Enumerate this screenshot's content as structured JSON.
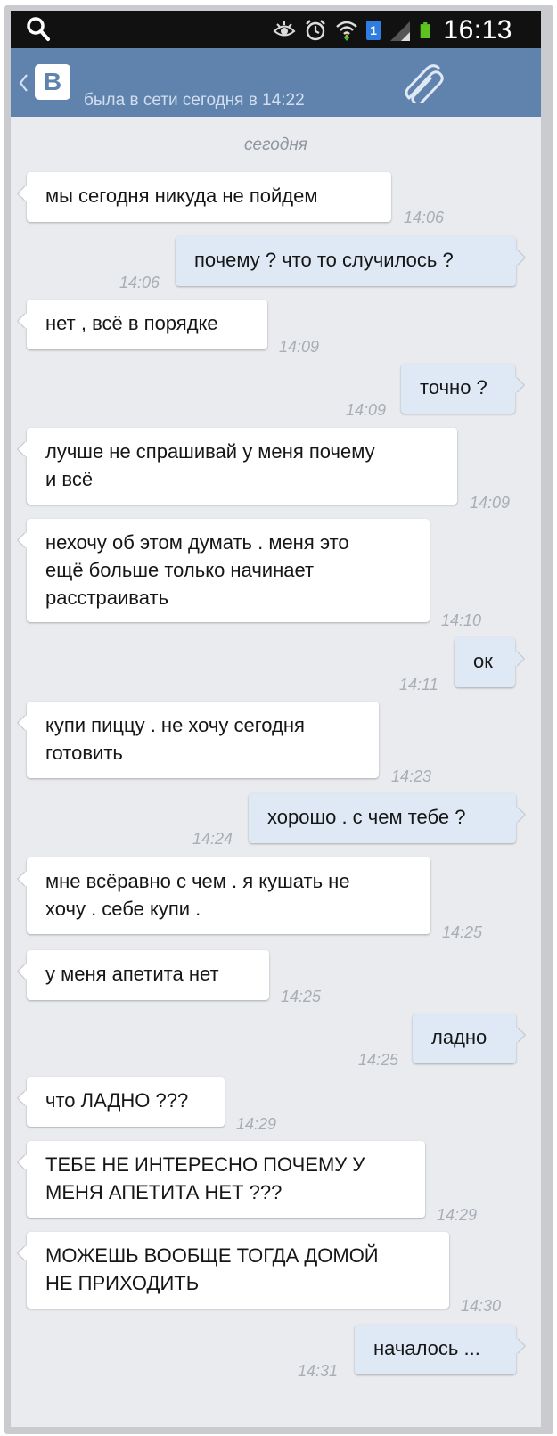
{
  "status_bar": {
    "time": "16:13",
    "badge": "1",
    "icons": [
      "search-icon",
      "eye-icon",
      "alarm-icon",
      "wifi-icon",
      "sim-badge-icon",
      "signal-icon",
      "battery-icon"
    ]
  },
  "header": {
    "logo": "В",
    "status": "была в сети сегодня в 14:22",
    "color": "#5f83ad"
  },
  "chat": {
    "date_label": "сегодня",
    "messages": [
      {
        "side": "in",
        "lines": [
          "мы сегодня никуда не пойдем"
        ],
        "time": "14:06"
      },
      {
        "side": "out",
        "lines": [
          "почему ? что то случилось ?"
        ],
        "time": "14:06"
      },
      {
        "side": "in",
        "lines": [
          "нет , всё в порядке"
        ],
        "time": "14:09"
      },
      {
        "side": "out",
        "lines": [
          "точно ?"
        ],
        "time": "14:09"
      },
      {
        "side": "in",
        "lines": [
          "лучше не спрашивай у меня почему",
          "и всё"
        ],
        "time": "14:09"
      },
      {
        "side": "in",
        "lines": [
          "нехочу об этом думать . меня это",
          "ещё больше только начинает",
          "расстраивать"
        ],
        "time": "14:10"
      },
      {
        "side": "out",
        "lines": [
          "ок"
        ],
        "time": "14:11"
      },
      {
        "side": "in",
        "lines": [
          "купи пиццу . не хочу сегодня",
          "готовить"
        ],
        "time": "14:23"
      },
      {
        "side": "out",
        "lines": [
          "хорошо . с чем тебе ?"
        ],
        "time": "14:24"
      },
      {
        "side": "in",
        "lines": [
          "мне всёравно с чем . я кушать не",
          "хочу . себе купи ."
        ],
        "time": "14:25"
      },
      {
        "side": "in",
        "lines": [
          "у меня апетита нет"
        ],
        "time": "14:25"
      },
      {
        "side": "out",
        "lines": [
          "ладно"
        ],
        "time": "14:25"
      },
      {
        "side": "in",
        "lines": [
          "что ЛАДНО ???"
        ],
        "time": "14:29"
      },
      {
        "side": "in",
        "lines": [
          "ТЕБЕ НЕ ИНТЕРЕСНО ПОЧЕМУ У",
          "МЕНЯ АПЕТИТА НЕТ ???"
        ],
        "time": "14:29"
      },
      {
        "side": "in",
        "lines": [
          "МОЖЕШЬ ВООБЩЕ ТОГДА ДОМОЙ",
          "НЕ ПРИХОДИТЬ"
        ],
        "time": "14:30"
      },
      {
        "side": "out",
        "lines": [
          "началось ..."
        ],
        "time": "14:31"
      }
    ]
  },
  "colors": {
    "incoming_bubble": "#ffffff",
    "outgoing_bubble": "#dfe9f5",
    "chat_background": "#e9ebee",
    "timestamp": "#a8aeb6"
  }
}
